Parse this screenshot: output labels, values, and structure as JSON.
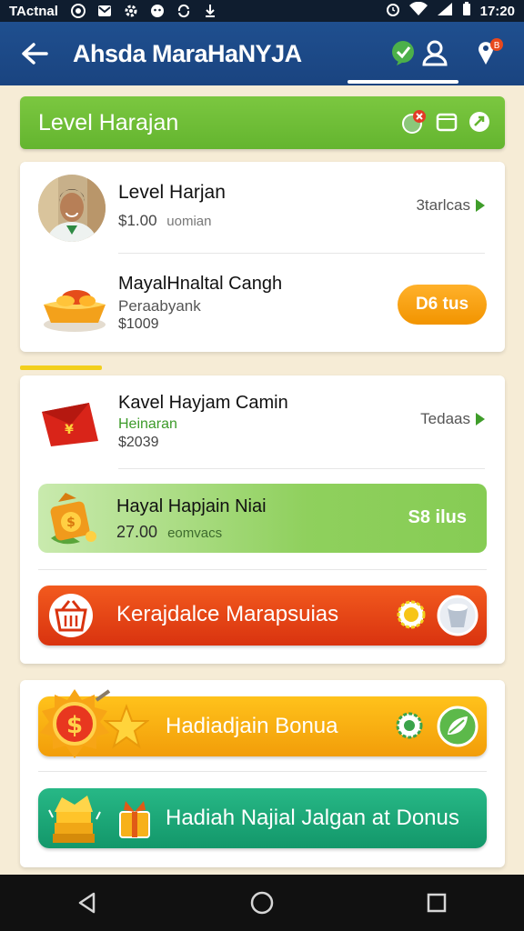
{
  "status_bar": {
    "carrier": "TActnal",
    "time": "17:20"
  },
  "app_bar": {
    "title": "Ahsda MaraHaNYJA"
  },
  "level_banner": {
    "label": "Level Harajan"
  },
  "card1": {
    "item1": {
      "title": "Level Harjan",
      "price": "$1.00",
      "price_note": "uomian",
      "link": "3tarlcas"
    },
    "item2": {
      "title": "MayalHnaltal Cangh",
      "subtitle": "Peraabyank",
      "price": "$1009",
      "button": "D6 tus"
    }
  },
  "card2": {
    "item1": {
      "title": "Kavel Hayjam Camin",
      "subtitle": "Heinaran",
      "price": "$2039",
      "link": "Tedaas"
    },
    "item2": {
      "title": "Hayal Hapjain Niai",
      "price": "27.00",
      "price_note": "eomvacs",
      "value": "S8 ilus"
    },
    "button": {
      "label": "Kerajdalce Marapsuias"
    }
  },
  "card3": {
    "bonus_button": "Hadiadjain Bonua",
    "bonus_button2": "Hadiah Najial Jalgan at Donus"
  },
  "colors": {
    "appbar": "#1f4f8f",
    "banner_green": "#6cbb35",
    "orange": "#f29400",
    "red": "#d9330f",
    "teal": "#13976a"
  }
}
